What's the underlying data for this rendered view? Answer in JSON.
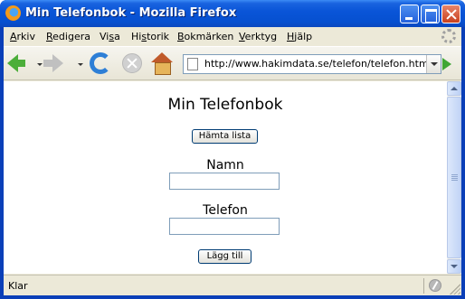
{
  "window": {
    "title": "Min Telefonbok - Mozilla Firefox"
  },
  "menu": {
    "items": [
      {
        "first": "A",
        "rest": "rkiv"
      },
      {
        "first": "R",
        "rest": "edigera"
      },
      {
        "first": "Vi",
        "u": "s",
        "rest": "a"
      },
      {
        "first": "Hi",
        "u": "s",
        "rest": "torik"
      },
      {
        "first": "B",
        "rest": "okmärken"
      },
      {
        "first": "V",
        "rest": "erktyg"
      },
      {
        "first": "H",
        "rest": "jälp"
      }
    ]
  },
  "navigation": {
    "url": "http://www.hakimdata.se/telefon/telefon.html"
  },
  "page": {
    "heading": "Min Telefonbok",
    "fetch_button": "Hämta lista",
    "name_label": "Namn",
    "name_value": "",
    "phone_label": "Telefon",
    "phone_value": "",
    "add_button": "Lägg till"
  },
  "status": {
    "text": "Klar"
  }
}
